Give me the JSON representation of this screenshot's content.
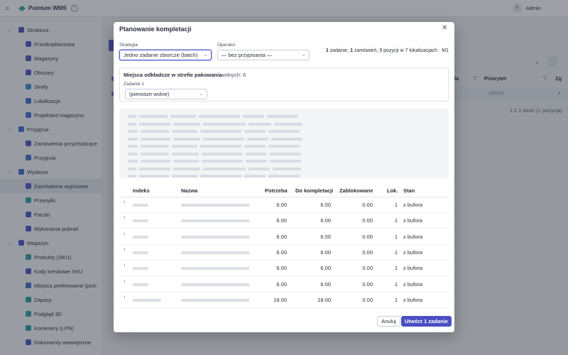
{
  "topbar": {
    "menu_icon": "hamburger-icon",
    "app_title": "Pointum WMS",
    "info_icon": "i",
    "avatar_initial": "A",
    "user_name": "Admin"
  },
  "sidebar": {
    "sections": [
      {
        "label": "Struktura",
        "icon": "building-icon",
        "color": "#4a55c8",
        "children": [
          {
            "label": "Przedsiębiorstwa",
            "icon": "document-icon",
            "color": "#4a55c8"
          },
          {
            "label": "Magazyny",
            "icon": "warehouse-icon",
            "color": "#4a55c8"
          },
          {
            "label": "Obszary",
            "icon": "area-icon",
            "color": "#4a55c8"
          },
          {
            "label": "Strefy",
            "icon": "zone-icon",
            "color": "#3b8fd0"
          },
          {
            "label": "Lokalizacje",
            "icon": "pin-icon",
            "color": "#3b6fd0"
          },
          {
            "label": "Projektant magazynu",
            "icon": "pencil-icon",
            "color": "#3b6fd0"
          }
        ]
      },
      {
        "label": "Przyjęcia",
        "icon": "user-icon",
        "color": "#3b6fd0",
        "children": [
          {
            "label": "Zamówienia przychodzące",
            "icon": "document-icon",
            "color": "#4a55c8"
          },
          {
            "label": "Przyjęcia",
            "icon": "user-icon",
            "color": "#3b6fd0"
          }
        ]
      },
      {
        "label": "Wydania",
        "icon": "user-icon",
        "color": "#3b6fd0",
        "children": [
          {
            "label": "Zamówienia wyjściowe",
            "icon": "document-icon",
            "color": "#4a55c8",
            "active": true
          },
          {
            "label": "Przesyłki",
            "icon": "truck-icon",
            "color": "#2aa0a0"
          },
          {
            "label": "Paczki",
            "icon": "package-icon",
            "color": "#4a55c8"
          },
          {
            "label": "Wykonania pobrań",
            "icon": "list-icon",
            "color": "#4a55c8"
          }
        ]
      },
      {
        "label": "Magazyn",
        "icon": "stack-icon",
        "color": "#4a55c8",
        "children": [
          {
            "label": "Produkty (SKU)",
            "icon": "tag-icon",
            "color": "#2aa0a0"
          },
          {
            "label": "Kody kreskowe SKU",
            "icon": "barcode-icon",
            "color": "#4a55c8"
          },
          {
            "label": "Miejsca preferowane (pick-",
            "icon": "pin-icon",
            "color": "#3b6fd0"
          },
          {
            "label": "Zapasy",
            "icon": "stock-icon",
            "color": "#2aa0a0"
          },
          {
            "label": "Podgląd 3D",
            "icon": "cube-icon",
            "color": "#2aa0a0"
          },
          {
            "label": "Kontenery (LPN)",
            "icon": "container-icon",
            "color": "#2aa0a0"
          },
          {
            "label": "Dokumenty wewnętrzne",
            "icon": "document-icon",
            "color": "#4a55c8"
          }
        ]
      }
    ]
  },
  "background_table": {
    "headers": [
      "la",
      "Priorytet",
      "Zg"
    ],
    "pagination": "1 z 1 stron (1 pozycja)"
  },
  "modal": {
    "title": "Planowanie kompletacji",
    "strategy_label": "Strategia",
    "strategy_value": "Jedno zadanie zbiorcze (batch)",
    "operator_label": "Operator",
    "operator_value": "— bez przypisania —",
    "summary": {
      "tasks_count": "1",
      "tasks_text": " zadanie, ",
      "orders_count": "1",
      "orders_text": " zamówień, 9 pozycji w 7 lokalizacjach · M1"
    },
    "staging": {
      "title": "Miejsca odkładcze w strefie pakowania",
      "free": "wolnych: 6",
      "task_label": "Zadanie 1",
      "task_value": "(pierwsze wolne)"
    },
    "table": {
      "headers": {
        "index": "Indeks",
        "name": "Nazwa",
        "need": "Potrzeba",
        "to_pick": "Do kompletacji",
        "blocked": "Zablokowane",
        "lok": "Lok.",
        "stan": "Stan"
      },
      "rows": [
        {
          "need": "6.00",
          "to_pick": "6.00",
          "blocked": "0.00",
          "lok": "1",
          "stan": "z bufora"
        },
        {
          "need": "6.00",
          "to_pick": "6.00",
          "blocked": "0.00",
          "lok": "1",
          "stan": "z bufora"
        },
        {
          "need": "6.00",
          "to_pick": "6.00",
          "blocked": "0.00",
          "lok": "1",
          "stan": "z bufora"
        },
        {
          "need": "6.00",
          "to_pick": "6.00",
          "blocked": "0.00",
          "lok": "1",
          "stan": "z bufora"
        },
        {
          "need": "6.00",
          "to_pick": "6.00",
          "blocked": "0.00",
          "lok": "1",
          "stan": "z bufora"
        },
        {
          "need": "6.00",
          "to_pick": "6.00",
          "blocked": "0.00",
          "lok": "1",
          "stan": "z bufora"
        },
        {
          "need": "18.00",
          "to_pick": "18.00",
          "blocked": "0.00",
          "lok": "1",
          "stan": "z bufora"
        }
      ]
    },
    "cancel_label": "Anuluj",
    "create_label": "Utwórz 1 zadanie"
  }
}
